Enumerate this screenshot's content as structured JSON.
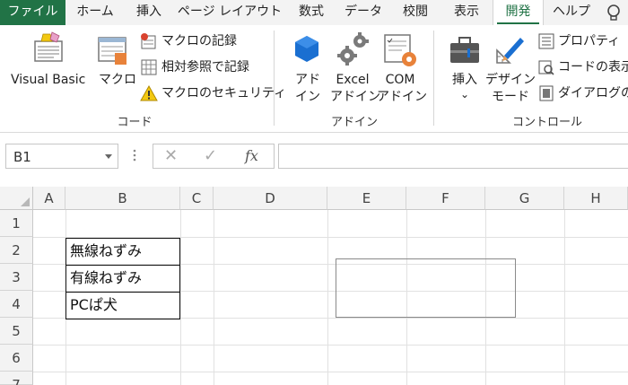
{
  "tabs": [
    {
      "label": "ファイル"
    },
    {
      "label": "ホーム"
    },
    {
      "label": "挿入"
    },
    {
      "label": "ページ レイアウト"
    },
    {
      "label": "数式"
    },
    {
      "label": "データ"
    },
    {
      "label": "校閲"
    },
    {
      "label": "表示"
    },
    {
      "label": "開発"
    },
    {
      "label": "ヘルプ"
    }
  ],
  "active_tab": "開発",
  "ribbon": {
    "code_group": {
      "visual_basic": "Visual Basic",
      "macro": "マクロ",
      "record_macro": "マクロの記録",
      "relative_ref": "相対参照で記録",
      "macro_security": "マクロのセキュリティ",
      "label": "コード"
    },
    "addins_group": {
      "addin_l1": "アド",
      "addin_l2": "イン",
      "excel_addin_l1": "Excel",
      "excel_addin_l2": "アドイン",
      "com_addin_l1": "COM",
      "com_addin_l2": "アドイン",
      "label": "アドイン"
    },
    "controls_group": {
      "insert": "挿入",
      "insert_arrow": "⌄",
      "design_mode_l1": "デザイン",
      "design_mode_l2": "モード",
      "properties": "プロパティ",
      "view_code": "コードの表示",
      "run_dialog": "ダイアログの実",
      "label": "コントロール"
    }
  },
  "formula_bar": {
    "name_box": "B1",
    "cancel_glyph": "✕",
    "enter_glyph": "✓",
    "fx_glyph": "fx",
    "formula": ""
  },
  "sheet": {
    "columns": [
      "A",
      "B",
      "C",
      "D",
      "E",
      "F",
      "G",
      "H"
    ],
    "rows": [
      "1",
      "2",
      "3",
      "4",
      "5",
      "6",
      "7"
    ],
    "cells": {
      "B2": "無線ねずみ",
      "B3": "有線ねずみ",
      "B4": "PCぱ犬"
    }
  },
  "colors": {
    "accent": "#217346",
    "header_bg": "#f3f3f3",
    "gridline": "#e1e1e1"
  }
}
